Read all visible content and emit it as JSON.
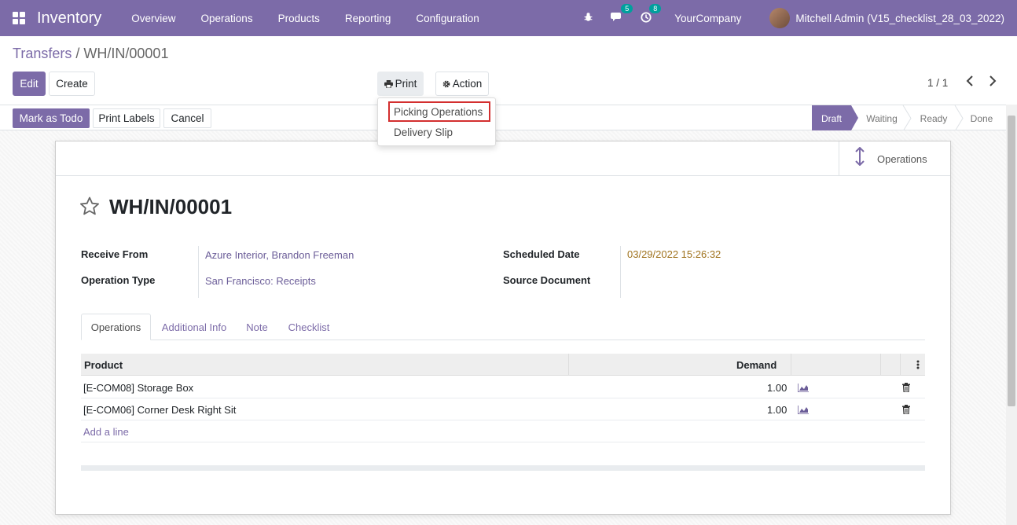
{
  "navbar": {
    "app_name": "Inventory",
    "menu": [
      "Overview",
      "Operations",
      "Products",
      "Reporting",
      "Configuration"
    ],
    "messages_count": "5",
    "activities_count": "8",
    "company": "YourCompany",
    "user": "Mitchell Admin (V15_checklist_28_03_2022)"
  },
  "breadcrumb": {
    "parent": "Transfers",
    "separator": "/",
    "current": "WH/IN/00001"
  },
  "control": {
    "edit_label": "Edit",
    "create_label": "Create",
    "print_label": "Print",
    "action_label": "Action",
    "pager": "1 / 1"
  },
  "print_menu": {
    "items": [
      "Picking Operations",
      "Delivery Slip"
    ],
    "highlighted": "Picking Operations"
  },
  "statusbar": {
    "buttons": [
      "Mark as Todo",
      "Print Labels",
      "Cancel"
    ],
    "stages": [
      "Draft",
      "Waiting",
      "Ready",
      "Done"
    ],
    "active_stage": "Draft"
  },
  "sheet": {
    "smart_button": "Operations",
    "title": "WH/IN/00001",
    "fields": {
      "receive_from_label": "Receive From",
      "receive_from": "Azure Interior, Brandon Freeman",
      "operation_type_label": "Operation Type",
      "operation_type": "San Francisco: Receipts",
      "scheduled_date_label": "Scheduled Date",
      "scheduled_date": "03/29/2022 15:26:32",
      "source_document_label": "Source Document",
      "source_document": ""
    },
    "tabs": [
      "Operations",
      "Additional Info",
      "Note",
      "Checklist"
    ],
    "active_tab": "Operations",
    "table": {
      "columns": [
        "Product",
        "Demand"
      ],
      "rows": [
        {
          "product": "[E-COM08] Storage Box",
          "demand": "1.00"
        },
        {
          "product": "[E-COM06] Corner Desk Right Sit",
          "demand": "1.00"
        }
      ],
      "add_line": "Add a line"
    }
  },
  "colors": {
    "brand": "#7c6ba8",
    "highlight_border": "#d32f2f",
    "date": "#a0731e"
  }
}
